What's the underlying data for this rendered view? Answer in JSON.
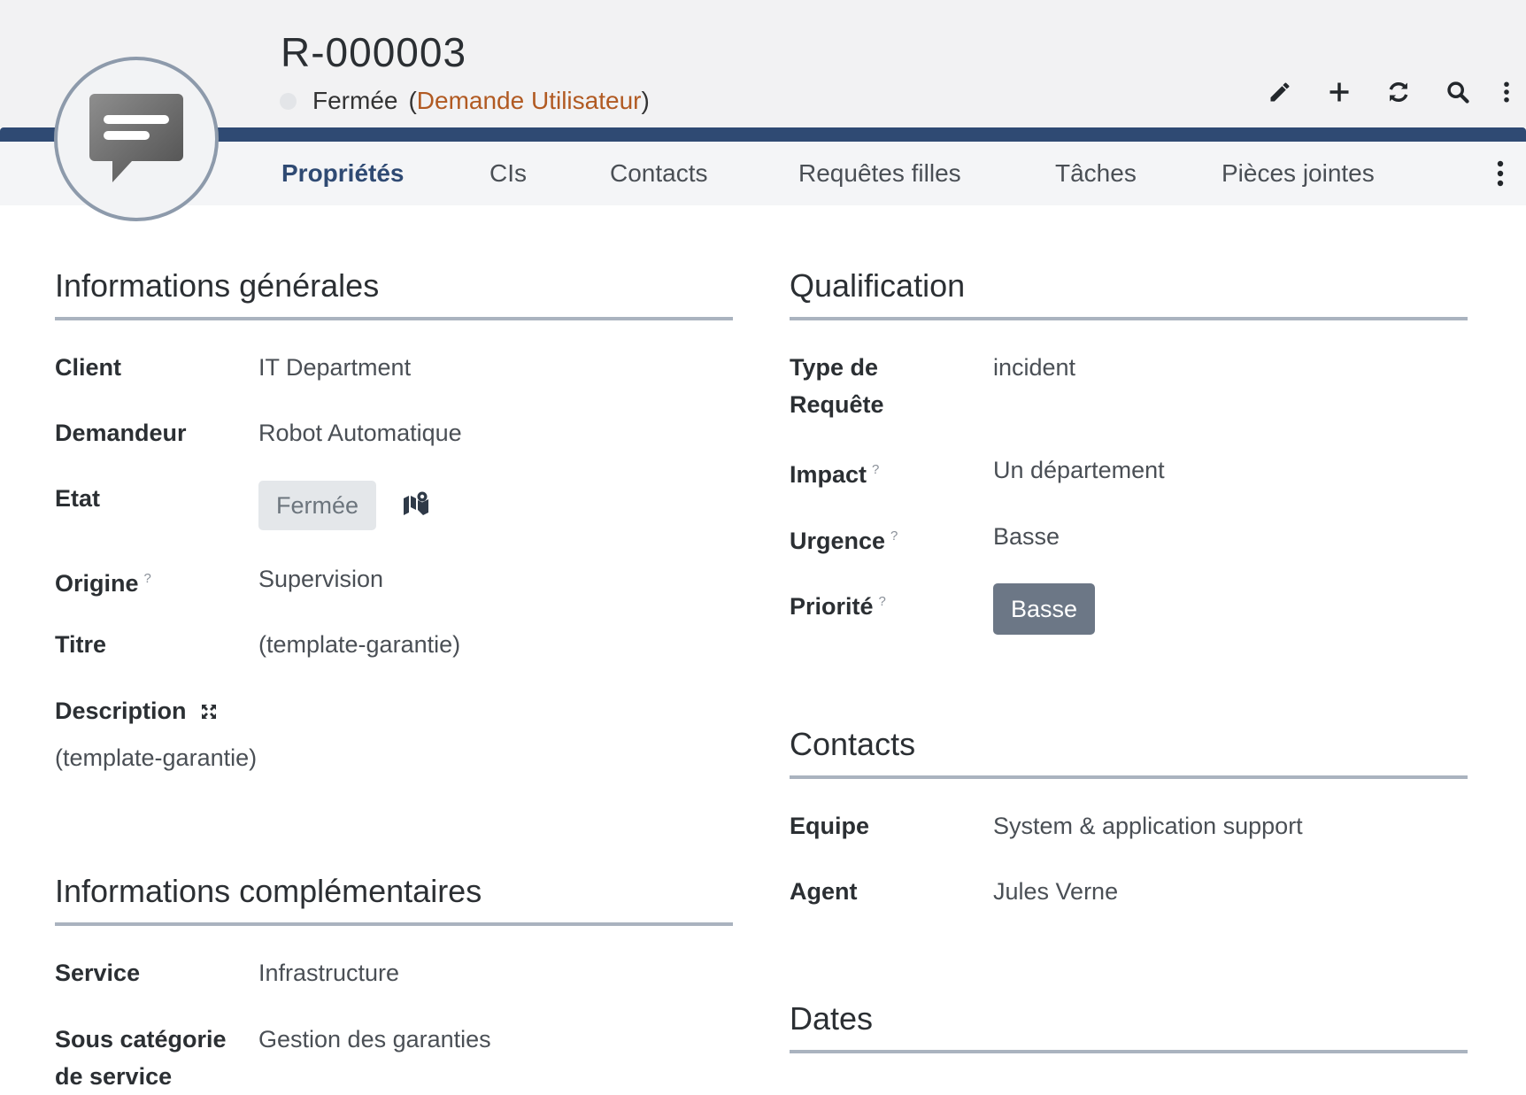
{
  "header": {
    "ref": "R-000003",
    "status": "Fermée",
    "type_open": "(",
    "type_link": "Demande Utilisateur",
    "type_close": ")"
  },
  "actions": [
    {
      "name": "edit",
      "icon": "pencil-icon"
    },
    {
      "name": "add",
      "icon": "plus-icon"
    },
    {
      "name": "refresh",
      "icon": "refresh-icon"
    },
    {
      "name": "search",
      "icon": "search-icon"
    },
    {
      "name": "more",
      "icon": "more-vertical-icon"
    }
  ],
  "tabs": [
    {
      "label": "Propriétés",
      "active": true
    },
    {
      "label": "CIs"
    },
    {
      "label": "Contacts"
    },
    {
      "label": "Requêtes filles"
    },
    {
      "label": "Tâches"
    },
    {
      "label": "Pièces jointes"
    }
  ],
  "colors": {
    "link": "#b15a22",
    "brand": "#2f4a73",
    "priority_badge": "#6c7786"
  },
  "general": {
    "title": "Informations générales",
    "client_label": "Client",
    "client_value": "IT Department",
    "demandeur_label": "Demandeur",
    "demandeur_value": "Robot Automatique",
    "etat_label": "Etat",
    "etat_value": "Fermée",
    "origine_label": "Origine",
    "origine_value": "Supervision",
    "titre_label": "Titre",
    "titre_value": "(template-garantie)",
    "description_label": "Description",
    "description_value": "(template-garantie)",
    "help": "?"
  },
  "complementary": {
    "title": "Informations complémentaires",
    "service_label": "Service",
    "service_value": "Infrastructure",
    "sous_cat_label_1": "Sous catégorie",
    "sous_cat_label_2": "de service",
    "sous_cat_value": "Gestion des garanties"
  },
  "qualification": {
    "title": "Qualification",
    "type_label_1": "Type de",
    "type_label_2": "Requête",
    "type_value": "incident",
    "impact_label": "Impact",
    "impact_value": "Un département",
    "urgence_label": "Urgence",
    "urgence_value": "Basse",
    "priorite_label": "Priorité",
    "priorite_value": "Basse"
  },
  "contacts": {
    "title": "Contacts",
    "equipe_label": "Equipe",
    "equipe_value": "System & application support",
    "agent_label": "Agent",
    "agent_value": "Jules Verne"
  },
  "dates": {
    "title": "Dates"
  }
}
